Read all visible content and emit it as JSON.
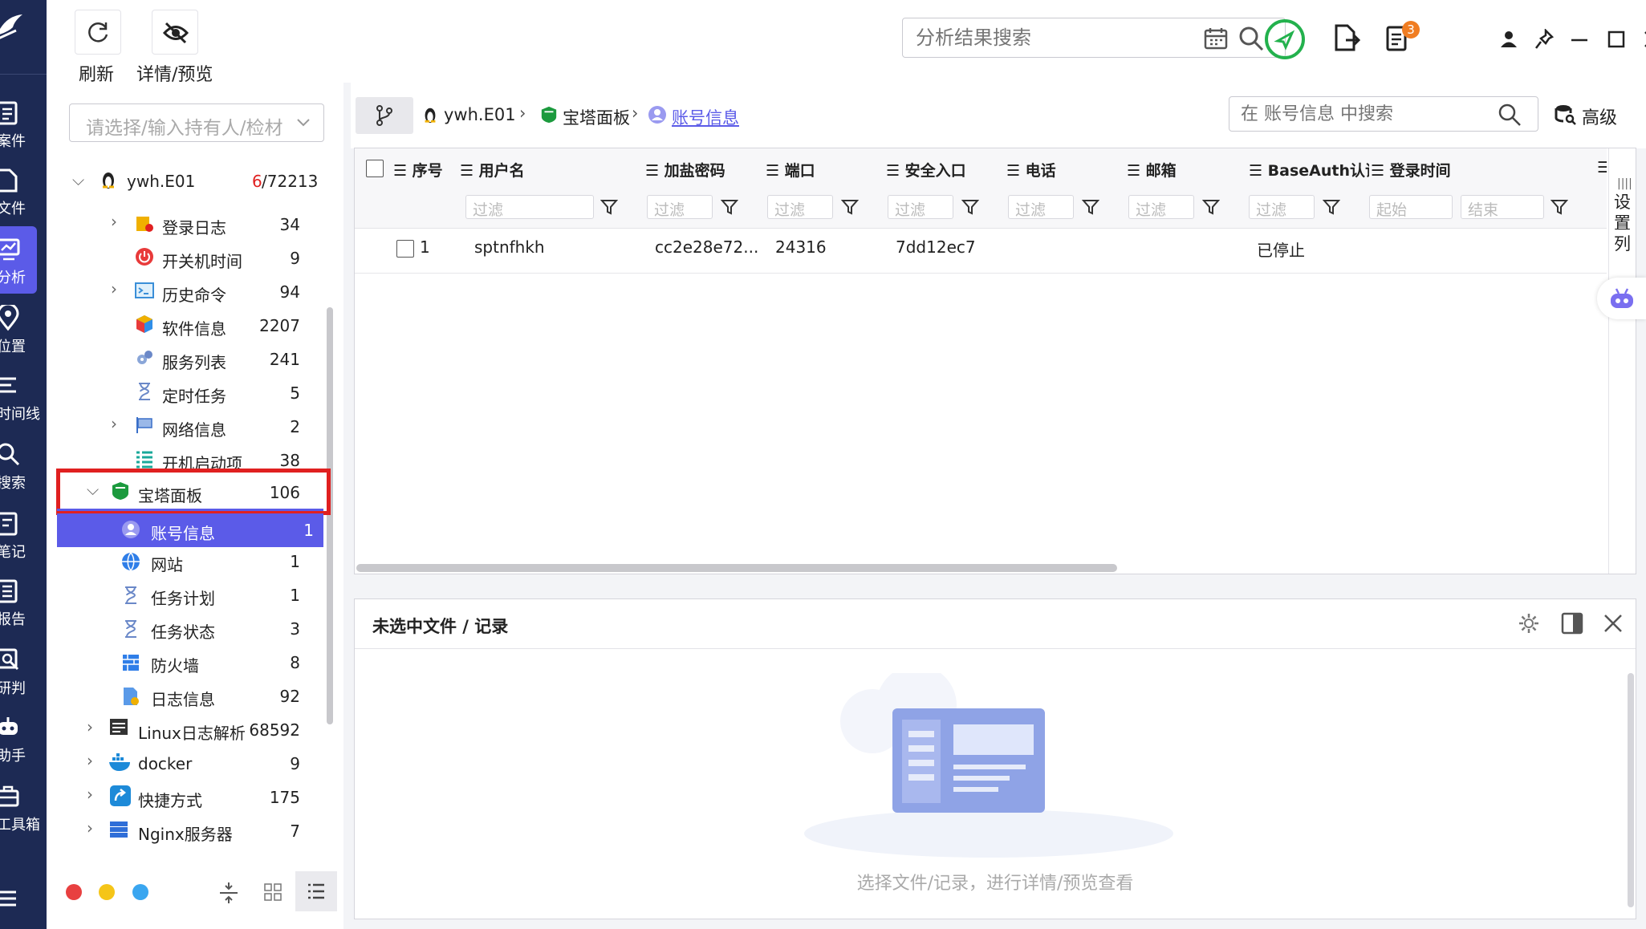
{
  "toolbar": {
    "refresh": "刷新",
    "details": "详情/预览"
  },
  "top_search": {
    "placeholder": "分析结果搜索"
  },
  "notification_count": "3",
  "rail": [
    {
      "label": "案件"
    },
    {
      "label": "文件"
    },
    {
      "label": "分析"
    },
    {
      "label": "位置"
    },
    {
      "label": "时间线"
    },
    {
      "label": "搜索"
    },
    {
      "label": "笔记"
    },
    {
      "label": "报告"
    },
    {
      "label": "研判"
    },
    {
      "label": "助手"
    },
    {
      "label": "工具箱"
    }
  ],
  "sidebar": {
    "holder_placeholder": "请选择/输入持有人/检材",
    "root": {
      "label": "ywh.E01",
      "count_red": "6",
      "count_total": "/72213"
    },
    "items": [
      {
        "label": "登录日志",
        "count": "34"
      },
      {
        "label": "开关机时间",
        "count": "9"
      },
      {
        "label": "历史命令",
        "count": "94"
      },
      {
        "label": "软件信息",
        "count": "2207"
      },
      {
        "label": "服务列表",
        "count": "241"
      },
      {
        "label": "定时任务",
        "count": "5"
      },
      {
        "label": "网络信息",
        "count": "2"
      },
      {
        "label": "开机启动项",
        "count": "38"
      },
      {
        "label": "宝塔面板",
        "count": "106"
      },
      {
        "label": "账号信息",
        "count": "1"
      },
      {
        "label": "网站",
        "count": "1"
      },
      {
        "label": "任务计划",
        "count": "1"
      },
      {
        "label": "任务状态",
        "count": "3"
      },
      {
        "label": "防火墙",
        "count": "8"
      },
      {
        "label": "日志信息",
        "count": "92"
      },
      {
        "label": "Linux日志解析",
        "count": "68592"
      },
      {
        "label": "docker",
        "count": "9"
      },
      {
        "label": "快捷方式",
        "count": "175"
      },
      {
        "label": "Nginx服务器",
        "count": "7"
      }
    ]
  },
  "breadcrumb": {
    "root": "ywh.E01",
    "mid": "宝塔面板",
    "current": "账号信息"
  },
  "grid_search": {
    "placeholder": "在 账号信息 中搜索",
    "advanced": "高级"
  },
  "grid": {
    "columns": [
      "序号",
      "用户名",
      "加盐密码",
      "端口",
      "安全入口",
      "电话",
      "邮箱",
      "BaseAuth认证",
      "登录时间"
    ],
    "filter": "过滤",
    "filter_start": "起始",
    "filter_end": "结束",
    "settings_col": "设置列",
    "rows": [
      {
        "index": "1",
        "username": "sptnfhkh",
        "password": "cc2e28e72...",
        "port": "24316",
        "entry": "7dd12ec7",
        "phone": "",
        "email": "",
        "baseauth": "已停止",
        "login_time": ""
      }
    ]
  },
  "preview": {
    "title": "未选中文件 / 记录",
    "empty_text": "选择文件/记录，进行详情/预览查看"
  },
  "colors": {
    "rail": "#1d2a54",
    "accent": "#5b5be8",
    "highlight": "#e02020"
  }
}
